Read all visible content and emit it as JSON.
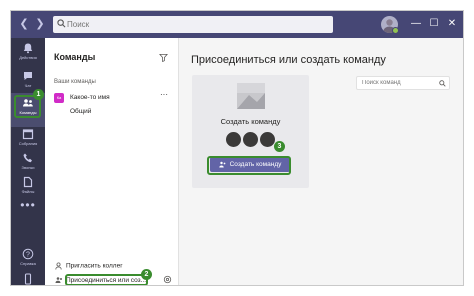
{
  "topbar": {
    "search_placeholder": "Поиск",
    "back_icon": "chevron-left-icon",
    "forward_icon": "chevron-right-icon",
    "minimize_label": "—",
    "maximize_label": "☐",
    "close_label": "✕"
  },
  "rail": {
    "items": [
      {
        "label": "Действия",
        "icon": "bell-icon"
      },
      {
        "label": "Чат",
        "icon": "chat-icon"
      },
      {
        "label": "Команды",
        "icon": "teams-icon"
      },
      {
        "label": "Собрания",
        "icon": "calendar-icon"
      },
      {
        "label": "Звонки",
        "icon": "phone-icon"
      },
      {
        "label": "Файлы",
        "icon": "files-icon"
      }
    ],
    "more_label": "•••",
    "help_label": "Справка",
    "help_icon": "help-icon",
    "device_icon": "mobile-icon"
  },
  "panel": {
    "title": "Команды",
    "section_label": "Ваши команды",
    "team_initials": "Ка",
    "team_name": "Какое-то имя",
    "team_more": "···",
    "channel": "Общий",
    "invite_label": "Пригласить коллег",
    "join_label": "Присоединиться или соз..."
  },
  "main": {
    "title": "Присоединиться или создать команду",
    "card_title": "Создать команду",
    "create_button": "Создать команду",
    "search_placeholder": "Поиск команд"
  },
  "badges": {
    "one": "1",
    "two": "2",
    "three": "3"
  },
  "colors": {
    "accent": "#6264a7",
    "topbar": "#464775",
    "rail": "#33344a",
    "highlight": "#3a8c2e",
    "team_tile": "#d12bc7"
  }
}
